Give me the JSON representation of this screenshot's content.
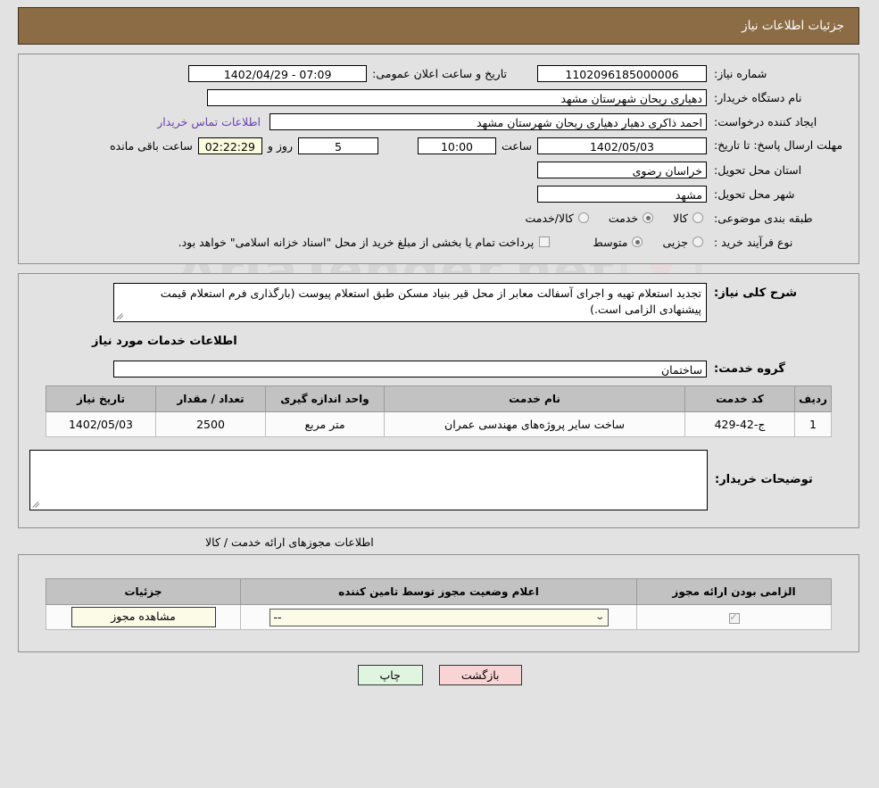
{
  "header": {
    "title": "جزئیات اطلاعات نیاز"
  },
  "watermark": {
    "text": "AriaTender.net"
  },
  "top": {
    "need_number_label": "شماره نیاز:",
    "need_number_value": "1102096185000006",
    "announce_datetime_label": "تاریخ و ساعت اعلان عمومی:",
    "announce_datetime_value": "07:09 - 1402/04/29",
    "buyer_org_label": "نام دستگاه خریدار:",
    "buyer_org_value": "دهیاری ریحان  شهرستان مشهد",
    "creator_label": "ایجاد کننده درخواست:",
    "creator_value": "احمد ذاکری دهیار دهیاری ریحان  شهرستان مشهد",
    "contact_link": "اطلاعات تماس خریدار",
    "deadline_label": "مهلت ارسال پاسخ: تا تاریخ:",
    "deadline_date": "1402/05/03",
    "hour_label": "ساعت",
    "deadline_time": "10:00",
    "days_value": "5",
    "days_label": "روز و",
    "countdown_value": "02:22:29",
    "countdown_label": "ساعت باقی مانده",
    "province_label": "استان محل تحویل:",
    "province_value": "خراسان رضوی",
    "city_label": "شهر محل تحویل:",
    "city_value": "مشهد",
    "category_label": "طبقه بندی موضوعی:",
    "category_options": [
      {
        "label": "کالا",
        "selected": false
      },
      {
        "label": "خدمت",
        "selected": true
      },
      {
        "label": "کالا/خدمت",
        "selected": false
      }
    ],
    "process_label": "نوع فرآیند خرید :",
    "process_options": [
      {
        "label": "جزیی",
        "selected": false
      },
      {
        "label": "متوسط",
        "selected": true
      }
    ],
    "payment_checkbox_checked": false,
    "payment_text": "پرداخت تمام یا بخشی از مبلغ خرید از محل \"اسناد خزانه اسلامی\" خواهد بود."
  },
  "description": {
    "label": "شرح کلی نیاز:",
    "value": "تجدید استعلام تهیه و اجرای آسفالت معابر از محل قیر  بنیاد مسکن طبق استعلام پیوست (بارگذاری فرم استعلام قیمت پیشنهادی الزامی است.)",
    "services_section_title": "اطلاعات خدمات مورد نیاز",
    "service_group_label": "گروه خدمت:",
    "service_group_value": "ساختمان"
  },
  "services_table": {
    "headers": [
      "ردیف",
      "کد خدمت",
      "نام خدمت",
      "واحد اندازه گیری",
      "تعداد / مقدار",
      "تاریخ نیاز"
    ],
    "rows": [
      {
        "row_no": "1",
        "service_code": "ج-42-429",
        "service_name": "ساخت سایر پروژه‌های مهندسی عمران",
        "unit": "متر مربع",
        "quantity": "2500",
        "need_date": "1402/05/03"
      }
    ]
  },
  "buyer_notes": {
    "label": "توضیحات خریدار:",
    "value": ""
  },
  "permits": {
    "caption": "اطلاعات مجوزهای ارائه خدمت / کالا",
    "headers": [
      "الزامی بودن ارائه مجوز",
      "اعلام وضعیت مجوز توسط تامین کننده",
      "جزئیات"
    ],
    "rows": [
      {
        "required_checked": true,
        "status_value": "--",
        "detail_button": "مشاهده مجوز"
      }
    ]
  },
  "footer": {
    "print_label": "چاپ",
    "back_label": "بازگشت"
  }
}
